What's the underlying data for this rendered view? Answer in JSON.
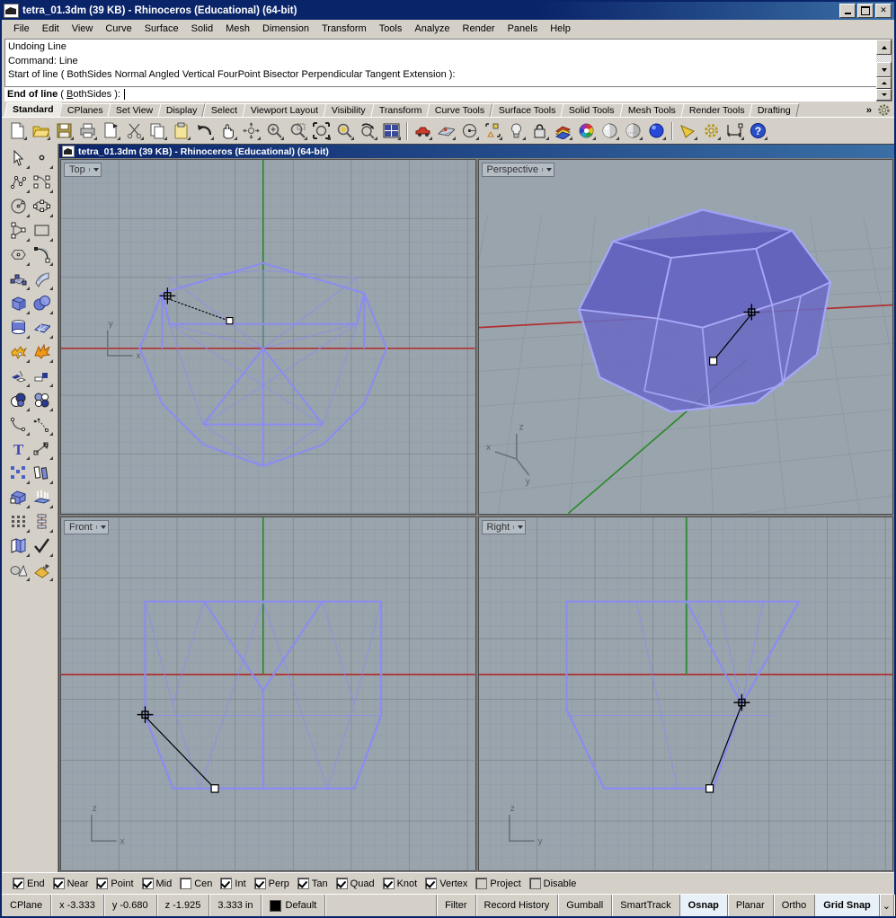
{
  "window": {
    "title": "tetra_01.3dm (39 KB) - Rhinoceros (Educational) (64-bit)",
    "minimize_label": "Minimize",
    "maximize_label": "Maximize",
    "close_label": "✕"
  },
  "menu": {
    "items": [
      {
        "label": "File"
      },
      {
        "label": "Edit"
      },
      {
        "label": "View"
      },
      {
        "label": "Curve"
      },
      {
        "label": "Surface"
      },
      {
        "label": "Solid"
      },
      {
        "label": "Mesh"
      },
      {
        "label": "Dimension"
      },
      {
        "label": "Transform"
      },
      {
        "label": "Tools"
      },
      {
        "label": "Analyze"
      },
      {
        "label": "Render"
      },
      {
        "label": "Panels"
      },
      {
        "label": "Help"
      }
    ]
  },
  "command": {
    "history": [
      "Undoing Line",
      "Command: Line",
      "Start of line ( BothSides  Normal  Angled  Vertical  FourPoint  Bisector  Perpendicular  Tangent  Extension ):"
    ],
    "prompt": "End of line",
    "prompt_options_pre": "( ",
    "prompt_option_underlined": "B",
    "prompt_option_rest": "othSides ):",
    "input_value": ""
  },
  "toolbar_tabs": {
    "items": [
      {
        "label": "Standard",
        "active": true
      },
      {
        "label": "CPlanes",
        "active": false
      },
      {
        "label": "Set View",
        "active": false
      },
      {
        "label": "Display",
        "active": false
      },
      {
        "label": "Select",
        "active": false
      },
      {
        "label": "Viewport Layout",
        "active": false
      },
      {
        "label": "Visibility",
        "active": false
      },
      {
        "label": "Transform",
        "active": false
      },
      {
        "label": "Curve Tools",
        "active": false
      },
      {
        "label": "Surface Tools",
        "active": false
      },
      {
        "label": "Solid Tools",
        "active": false
      },
      {
        "label": "Mesh Tools",
        "active": false
      },
      {
        "label": "Render Tools",
        "active": false
      },
      {
        "label": "Drafting",
        "active": false
      }
    ],
    "overflow_label": "»",
    "options_icon": "gear-icon"
  },
  "main_toolbar": {
    "icons": [
      "new-file-icon",
      "open-folder-icon",
      "save-icon",
      "print-icon",
      "copy-to-clipboard-icon",
      "cut-scissors-icon",
      "copy-icon",
      "paste-icon",
      "undo-icon",
      "pan-hand-icon",
      "rotate-view-icon",
      "zoom-in-icon",
      "zoom-window-icon",
      "zoom-extents-icon",
      "zoom-selected-icon",
      "zoom-previous-icon",
      "four-viewport-icon",
      "car-render-icon",
      "cplane-grid-icon",
      "circle-center-icon",
      "object-snap-icon",
      "light-bulb-icon",
      "lock-icon",
      "layer-icon",
      "color-wheel-icon",
      "shade-sphere-icon",
      "render-preview-icon",
      "render-sphere-icon",
      "view-cone-icon",
      "options-gear-icon",
      "dimension-icon",
      "help-icon"
    ]
  },
  "sidebar": {
    "icons": [
      "select-arrow-icon",
      "point-icon",
      "polyline-icon",
      "control-point-curve-icon",
      "circle-icon",
      "ellipse-icon",
      "polygon-triangle-icon",
      "rectangle-icon",
      "polygon-icon",
      "arc-icon",
      "surface-from-points-icon",
      "loft-surface-icon",
      "box-icon",
      "sphere-boolean-icon",
      "cylinder-icon",
      "surface-grid-icon",
      "explode-icon",
      "blast-icon",
      "split-icon",
      "trim-icon",
      "boolean-union-icon",
      "boolean-difference-icon",
      "fillet-curve-icon",
      "blend-curve-icon",
      "text-icon",
      "leader-icon",
      "array-icon",
      "offset-icon",
      "extrude-solid-icon",
      "extrude-surface-icon",
      "rectangular-array-icon",
      "analyze-direction-icon",
      "copy-object-icon",
      "check-icon",
      "render-mesh-icon",
      "apply-material-icon"
    ]
  },
  "mdi": {
    "title": "tetra_01.3dm (39 KB) - Rhinoceros (Educational) (64-bit)"
  },
  "viewports": [
    {
      "name": "Top",
      "dropdown_icon": "chevron-down-icon",
      "axis_labels": [
        "y",
        "x"
      ],
      "shaded": false
    },
    {
      "name": "Perspective",
      "dropdown_icon": "chevron-down-icon",
      "axis_labels": [
        "z",
        "x",
        "y"
      ],
      "shaded": true
    },
    {
      "name": "Front",
      "dropdown_icon": "chevron-down-icon",
      "axis_labels": [
        "z",
        "x"
      ],
      "shaded": false
    },
    {
      "name": "Right",
      "dropdown_icon": "chevron-down-icon",
      "axis_labels": [
        "z",
        "y"
      ],
      "shaded": false
    }
  ],
  "osnap": {
    "items": [
      {
        "label": "End",
        "checked": true,
        "disabled": false
      },
      {
        "label": "Near",
        "checked": true,
        "disabled": false
      },
      {
        "label": "Point",
        "checked": true,
        "disabled": false
      },
      {
        "label": "Mid",
        "checked": true,
        "disabled": false
      },
      {
        "label": "Cen",
        "checked": false,
        "disabled": false
      },
      {
        "label": "Int",
        "checked": true,
        "disabled": false
      },
      {
        "label": "Perp",
        "checked": true,
        "disabled": false
      },
      {
        "label": "Tan",
        "checked": true,
        "disabled": false
      },
      {
        "label": "Quad",
        "checked": true,
        "disabled": false
      },
      {
        "label": "Knot",
        "checked": true,
        "disabled": false
      },
      {
        "label": "Vertex",
        "checked": true,
        "disabled": false
      },
      {
        "label": "Project",
        "checked": false,
        "disabled": true
      },
      {
        "label": "Disable",
        "checked": false,
        "disabled": true
      }
    ]
  },
  "statusbar": {
    "cplane_label": "CPlane",
    "x_value": "x -3.333",
    "y_value": "y -0.680",
    "z_value": "z -1.925",
    "units": "3.333 in",
    "layer_color": "#000000",
    "layer_name": "Default",
    "toggles": [
      {
        "label": "Grid Snap",
        "active": true
      },
      {
        "label": "Ortho",
        "active": false
      },
      {
        "label": "Planar",
        "active": false
      },
      {
        "label": "Osnap",
        "active": true
      },
      {
        "label": "SmartTrack",
        "active": false
      },
      {
        "label": "Gumball",
        "active": false
      },
      {
        "label": "Record History",
        "active": false
      },
      {
        "label": "Filter",
        "active": false
      }
    ]
  },
  "colors": {
    "title_bar": "#0a246a",
    "chrome": "#d4d0c8",
    "viewport_bg": "#9aa4ad",
    "wireframe": "#8c8cf0",
    "solid_fill": "#6f6fc8",
    "x_axis": "#b03030",
    "y_axis": "#2e8b2e",
    "rubber_band": "#000000"
  },
  "geometry": {
    "description": "Dodecahedron-like polyhedron wireframe with active Line command rubber-band"
  }
}
